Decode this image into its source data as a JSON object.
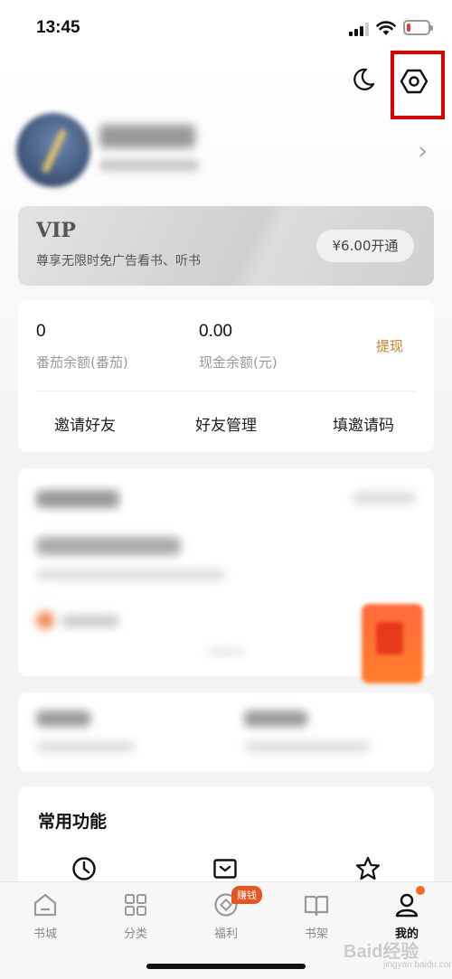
{
  "status_bar": {
    "time": "13:45"
  },
  "header": {
    "night_mode_icon": "moon-icon",
    "settings_icon": "settings-hexagon-icon",
    "profile_chevron": "›"
  },
  "vip": {
    "title": "VIP",
    "description": "尊享无限时免广告看书、听书",
    "button": "¥6.00开通"
  },
  "wallet": {
    "tomato_balance": "0",
    "tomato_label": "番茄余额(番茄)",
    "cash_balance": "0.00",
    "cash_label": "现金余额(元)",
    "withdraw": "提现",
    "actions": [
      "邀请好友",
      "好友管理",
      "填邀请码"
    ]
  },
  "common_functions": {
    "title": "常用功能",
    "icons": [
      "clock-icon",
      "inbox-icon",
      "star-icon"
    ]
  },
  "tabbar": {
    "items": [
      {
        "label": "书城",
        "icon": "home-icon"
      },
      {
        "label": "分类",
        "icon": "grid-icon"
      },
      {
        "label": "福利",
        "icon": "coin-icon"
      },
      {
        "label": "书架",
        "icon": "book-icon"
      },
      {
        "label": "我的",
        "icon": "person-icon"
      }
    ],
    "earn_badge": "赚钱",
    "active": "我的"
  },
  "watermark": {
    "brand": "Baid经验",
    "url": "jingyan.baidu.com"
  },
  "colors": {
    "accent": "#d97b2b",
    "highlight_box": "#e00000",
    "badge": "#e8541e"
  }
}
